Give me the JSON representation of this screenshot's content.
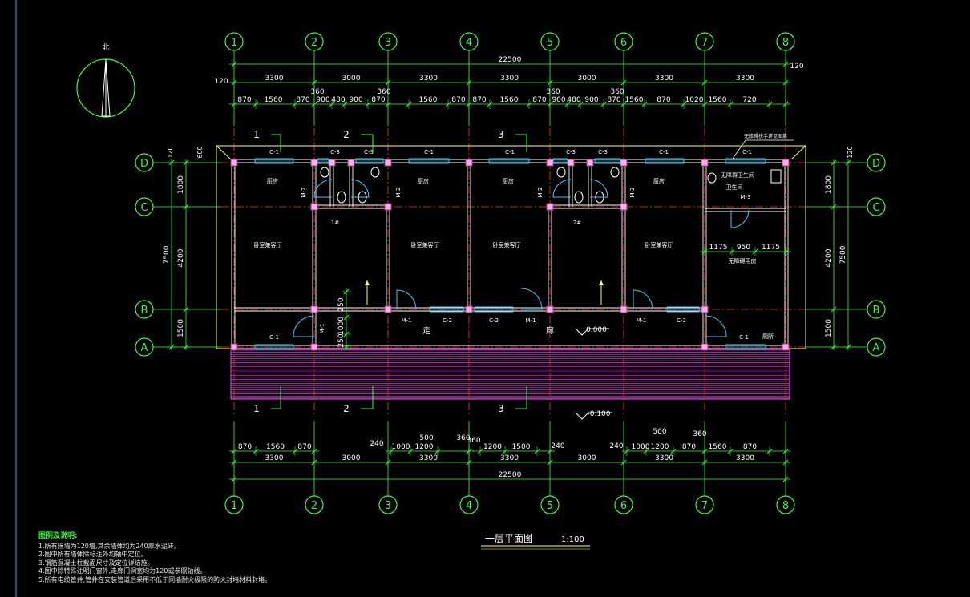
{
  "drawing": {
    "north_label": "北",
    "title": "一层平面图",
    "scale": "1:100",
    "axes_columns": [
      "1",
      "2",
      "3",
      "4",
      "5",
      "6",
      "7",
      "8"
    ],
    "axes_rows": [
      "D",
      "C",
      "B",
      "A"
    ],
    "total_dim": "22500",
    "top_bays": [
      "3300",
      "3000",
      "3300",
      "3300",
      "3000",
      "3300",
      "3300"
    ],
    "top_detail": [
      "870",
      "1560",
      "870",
      "900",
      "480",
      "900",
      "870",
      "1560",
      "870",
      "870",
      "1560",
      "870",
      "900",
      "480",
      "900",
      "870",
      "1560",
      "870",
      "1020",
      "1560",
      "720"
    ],
    "top_extra": [
      "360",
      "360",
      "360",
      "360"
    ],
    "edge_120": "120",
    "left_dims": [
      "1800",
      "4200",
      "1500"
    ],
    "left_total": "7500",
    "right_dims": [
      "1800",
      "4200",
      "1500"
    ],
    "right_total": "7500",
    "left_600": "600",
    "unit_labels": [
      "1",
      "2",
      "3"
    ],
    "rooms": {
      "kitchen": "厨房",
      "living": "卧室兼客厅",
      "unit1": "1#",
      "unit2": "2#",
      "wc": "无障碍卫生间",
      "wc_short": "卫生间",
      "accessible_room": "无障碍用房",
      "corridor_a": "走",
      "corridor_b": "廊",
      "storage": "厕所"
    },
    "windows": [
      "C-1",
      "C-2",
      "C-3"
    ],
    "doors": [
      "M-1",
      "M-2",
      "M-3"
    ],
    "elev_zero": "0.000",
    "elev_minus": "-0.100",
    "dims_small": [
      "1175",
      "950",
      "1175"
    ],
    "dims_mid": [
      "250",
      "1000",
      "250"
    ],
    "bottom_detail_1": [
      "870",
      "1560",
      "870"
    ],
    "bottom_detail_2": [
      "1000",
      "1200",
      "1500"
    ],
    "bottom_detail_3": [
      "1000",
      "1200",
      "870",
      "1560",
      "870"
    ],
    "bottom_small": [
      "240",
      "500",
      "360",
      "360",
      "240",
      "240",
      "500",
      "360"
    ],
    "bottom_bays": [
      "3300",
      "3000",
      "3300",
      "3300",
      "3000",
      "3300",
      "3300"
    ],
    "callout": "无障碍扶手详见图集"
  },
  "notes": {
    "title": "图例及说明:",
    "lines": [
      "1.所有隔墙为120墙,其余墙体均为240厚水泥砖。",
      "2.图中所有墙体除标注外均轴中定位。",
      "3.钢筋混凝土柱截面尺寸及定位详结施。",
      "4.图中除特殊注明门窗外,走廊门洞宽均为120或参照轴线。",
      "5.所有电缆管井,管井在安装管道后采用不低于同墙耐火极限的防火封堵材料封堵。"
    ]
  }
}
